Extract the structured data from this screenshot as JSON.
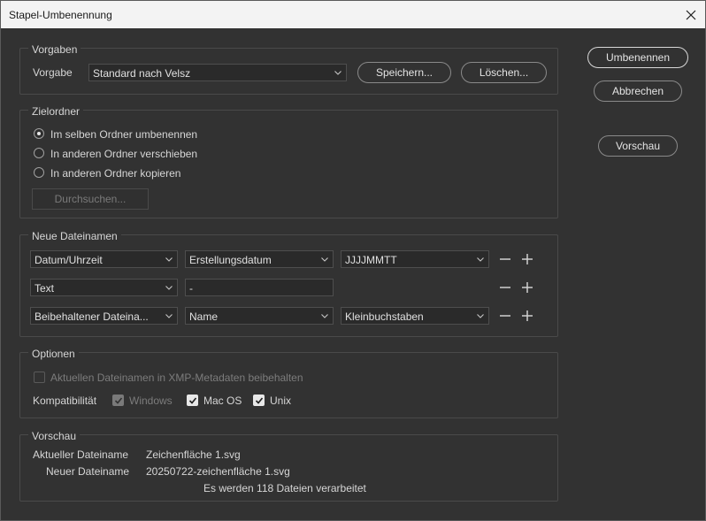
{
  "window": {
    "title": "Stapel-Umbenennung"
  },
  "vorgaben": {
    "group_label": "Vorgaben",
    "preset_label": "Vorgabe",
    "preset_value": "Standard nach Velsz",
    "save_label": "Speichern...",
    "delete_label": "Löschen..."
  },
  "zielordner": {
    "group_label": "Zielordner",
    "options": [
      {
        "label": "Im selben Ordner umbenennen",
        "selected": true
      },
      {
        "label": "In anderen Ordner verschieben",
        "selected": false
      },
      {
        "label": "In anderen Ordner kopieren",
        "selected": false
      }
    ],
    "browse_label": "Durchsuchen..."
  },
  "neue_dateinamen": {
    "group_label": "Neue Dateinamen",
    "rows": [
      {
        "type": "Datum/Uhrzeit",
        "source": "Erstellungsdatum",
        "format": "JJJJMMTT"
      },
      {
        "type": "Text",
        "text_value": "-"
      },
      {
        "type": "Beibehaltener Dateina...",
        "source": "Name",
        "format": "Kleinbuchstaben"
      }
    ]
  },
  "optionen": {
    "group_label": "Optionen",
    "xmp_label": "Aktuellen Dateinamen in XMP-Metadaten beibehalten",
    "xmp_checked": false,
    "compat_label": "Kompatibilität",
    "windows_label": "Windows",
    "windows_checked": true,
    "macos_label": "Mac OS",
    "macos_checked": true,
    "unix_label": "Unix",
    "unix_checked": true
  },
  "vorschau": {
    "group_label": "Vorschau",
    "current_label": "Aktueller Dateiname",
    "current_value": "Zeichenfläche 1.svg",
    "new_label": "Neuer Dateiname",
    "new_value": "20250722-zeichenfläche 1.svg",
    "summary": "Es werden 118 Dateien verarbeitet"
  },
  "actions": {
    "rename_label": "Umbenennen",
    "cancel_label": "Abbrechen",
    "preview_label": "Vorschau"
  },
  "icons": {
    "close": "close-icon",
    "chevron": "chevron-down-icon",
    "minus": "minus-icon",
    "plus": "plus-icon",
    "check": "checkmark-icon"
  },
  "colors": {
    "dialog_bg": "#323232",
    "titlebar_bg": "#f3f3f3",
    "field_bg": "#2a2a2a",
    "text": "#d6d6d6"
  }
}
